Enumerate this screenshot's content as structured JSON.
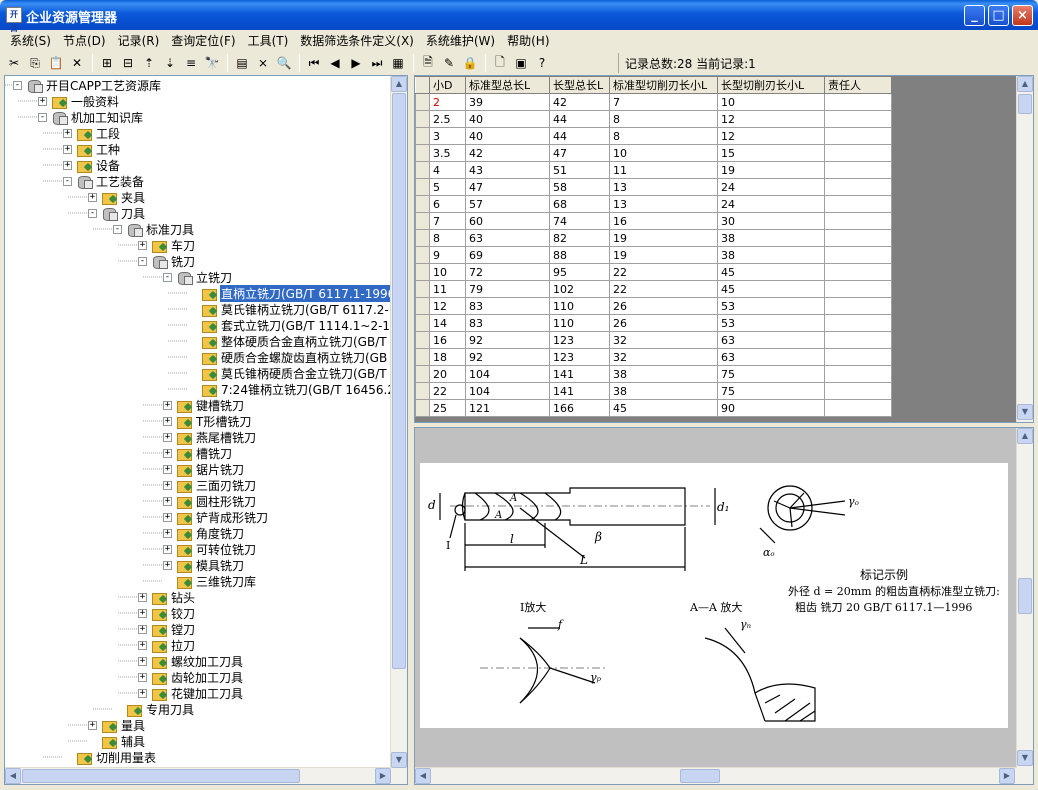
{
  "window": {
    "title": "企业资源管理器",
    "app_icon": "app-icon",
    "buttons": {
      "minimize": "_",
      "maximize": "□",
      "close": "×"
    }
  },
  "menu": [
    {
      "label": "系统(S)"
    },
    {
      "label": "节点(D)"
    },
    {
      "label": "记录(R)"
    },
    {
      "label": "查询定位(F)"
    },
    {
      "label": "工具(T)"
    },
    {
      "label": "数据筛选条件定义(X)"
    },
    {
      "label": "系统维护(W)"
    },
    {
      "label": "帮助(H)"
    }
  ],
  "toolbar": {
    "icons": [
      "cut-icon",
      "copy-icon",
      "paste-icon",
      "delete-icon",
      "new-node-icon",
      "new-child-icon",
      "move-up-icon",
      "move-down-icon",
      "level-icon",
      "find-icon",
      "table-icon",
      "filter-icon",
      "preview-icon",
      "first-record-icon",
      "prev-record-icon",
      "next-record-icon",
      "last-record-icon",
      "grid-icon",
      "properties-icon",
      "edit-icon",
      "lock-icon",
      "document-icon",
      "window-icon",
      "help-icon"
    ],
    "glyphs": [
      "✂",
      "⎘",
      "📋",
      "✕",
      "⊞",
      "⊟",
      "⇡",
      "⇣",
      "≡",
      "🔭",
      "▤",
      "⨯",
      "🔍",
      "⏮",
      "◀",
      "▶",
      "⏭",
      "▦",
      "🗎",
      "✎",
      "🔒",
      "🗋",
      "▣",
      "?"
    ],
    "status": "记录总数:28 当前记录:1"
  },
  "tree": [
    {
      "label": "开目CAPP工艺资源库",
      "level": 0,
      "exp": "-",
      "icon": "db"
    },
    {
      "label": "一般资料",
      "level": 1,
      "exp": "+",
      "icon": "folder"
    },
    {
      "label": "机加工知识库",
      "level": 1,
      "exp": "-",
      "icon": "db"
    },
    {
      "label": "工段",
      "level": 2,
      "exp": "+",
      "icon": "folder"
    },
    {
      "label": "工种",
      "level": 2,
      "exp": "+",
      "icon": "folder"
    },
    {
      "label": "设备",
      "level": 2,
      "exp": "+",
      "icon": "folder"
    },
    {
      "label": "工艺装备",
      "level": 2,
      "exp": "-",
      "icon": "db"
    },
    {
      "label": "夹具",
      "level": 3,
      "exp": "+",
      "icon": "folder"
    },
    {
      "label": "刀具",
      "level": 3,
      "exp": "-",
      "icon": "db"
    },
    {
      "label": "标准刀具",
      "level": 4,
      "exp": "-",
      "icon": "db"
    },
    {
      "label": "车刀",
      "level": 5,
      "exp": "+",
      "icon": "folder"
    },
    {
      "label": "铣刀",
      "level": 5,
      "exp": "-",
      "icon": "db"
    },
    {
      "label": "立铣刀",
      "level": 6,
      "exp": "-",
      "icon": "db"
    },
    {
      "label": "直柄立铣刀(GB/T 6117.1-1996",
      "level": 7,
      "exp": "",
      "icon": "folder",
      "selected": true
    },
    {
      "label": "莫氏锥柄立铣刀(GB/T 6117.2-",
      "level": 7,
      "exp": "",
      "icon": "folder"
    },
    {
      "label": "套式立铣刀(GB/T 1114.1~2-1'",
      "level": 7,
      "exp": "",
      "icon": "folder"
    },
    {
      "label": "整体硬质合金直柄立铣刀(GB/T",
      "level": 7,
      "exp": "",
      "icon": "folder"
    },
    {
      "label": "硬质合金螺旋齿直柄立铣刀(GB",
      "level": 7,
      "exp": "",
      "icon": "folder"
    },
    {
      "label": "莫氏锥柄硬质合金立铣刀(GB/T",
      "level": 7,
      "exp": "",
      "icon": "folder"
    },
    {
      "label": "7:24锥柄立铣刀(GB/T 16456.2",
      "level": 7,
      "exp": "",
      "icon": "folder"
    },
    {
      "label": "键槽铣刀",
      "level": 6,
      "exp": "+",
      "icon": "folder"
    },
    {
      "label": "T形槽铣刀",
      "level": 6,
      "exp": "+",
      "icon": "folder"
    },
    {
      "label": "燕尾槽铣刀",
      "level": 6,
      "exp": "+",
      "icon": "folder"
    },
    {
      "label": "槽铣刀",
      "level": 6,
      "exp": "+",
      "icon": "folder"
    },
    {
      "label": "锯片铣刀",
      "level": 6,
      "exp": "+",
      "icon": "folder"
    },
    {
      "label": "三面刃铣刀",
      "level": 6,
      "exp": "+",
      "icon": "folder"
    },
    {
      "label": "圆柱形铣刀",
      "level": 6,
      "exp": "+",
      "icon": "folder"
    },
    {
      "label": "铲背成形铣刀",
      "level": 6,
      "exp": "+",
      "icon": "folder"
    },
    {
      "label": "角度铣刀",
      "level": 6,
      "exp": "+",
      "icon": "folder"
    },
    {
      "label": "可转位铣刀",
      "level": 6,
      "exp": "+",
      "icon": "folder"
    },
    {
      "label": "模具铣刀",
      "level": 6,
      "exp": "+",
      "icon": "folder"
    },
    {
      "label": "三维铣刀库",
      "level": 6,
      "exp": "",
      "icon": "folder"
    },
    {
      "label": "钻头",
      "level": 5,
      "exp": "+",
      "icon": "folder"
    },
    {
      "label": "铰刀",
      "level": 5,
      "exp": "+",
      "icon": "folder"
    },
    {
      "label": "镗刀",
      "level": 5,
      "exp": "+",
      "icon": "folder"
    },
    {
      "label": "拉刀",
      "level": 5,
      "exp": "+",
      "icon": "folder"
    },
    {
      "label": "螺纹加工刀具",
      "level": 5,
      "exp": "+",
      "icon": "folder"
    },
    {
      "label": "齿轮加工刀具",
      "level": 5,
      "exp": "+",
      "icon": "folder"
    },
    {
      "label": "花键加工刀具",
      "level": 5,
      "exp": "+",
      "icon": "folder"
    },
    {
      "label": "专用刀具",
      "level": 4,
      "exp": "",
      "icon": "folder"
    },
    {
      "label": "量具",
      "level": 3,
      "exp": "+",
      "icon": "folder"
    },
    {
      "label": "辅具",
      "level": 3,
      "exp": "",
      "icon": "folder"
    },
    {
      "label": "切削用量表",
      "level": 2,
      "exp": "",
      "icon": "folder"
    }
  ],
  "grid": {
    "columns": [
      "小D",
      "标准型总长L",
      "长型总长L",
      "标准型切削刃长小L",
      "长型切削刃长小L",
      "责任人"
    ],
    "rows": [
      [
        "2",
        "39",
        "42",
        "7",
        "10",
        ""
      ],
      [
        "2.5",
        "40",
        "44",
        "8",
        "12",
        ""
      ],
      [
        "3",
        "40",
        "44",
        "8",
        "12",
        ""
      ],
      [
        "3.5",
        "42",
        "47",
        "10",
        "15",
        ""
      ],
      [
        "4",
        "43",
        "51",
        "11",
        "19",
        ""
      ],
      [
        "5",
        "47",
        "58",
        "13",
        "24",
        ""
      ],
      [
        "6",
        "57",
        "68",
        "13",
        "24",
        ""
      ],
      [
        "7",
        "60",
        "74",
        "16",
        "30",
        ""
      ],
      [
        "8",
        "63",
        "82",
        "19",
        "38",
        ""
      ],
      [
        "9",
        "69",
        "88",
        "19",
        "38",
        ""
      ],
      [
        "10",
        "72",
        "95",
        "22",
        "45",
        ""
      ],
      [
        "11",
        "79",
        "102",
        "22",
        "45",
        ""
      ],
      [
        "12",
        "83",
        "110",
        "26",
        "53",
        ""
      ],
      [
        "14",
        "83",
        "110",
        "26",
        "53",
        ""
      ],
      [
        "16",
        "92",
        "123",
        "32",
        "63",
        ""
      ],
      [
        "18",
        "92",
        "123",
        "32",
        "63",
        ""
      ],
      [
        "20",
        "104",
        "141",
        "38",
        "75",
        ""
      ],
      [
        "22",
        "104",
        "141",
        "38",
        "75",
        ""
      ],
      [
        "25",
        "121",
        "166",
        "45",
        "90",
        ""
      ]
    ]
  },
  "drawing": {
    "labels": {
      "d": "d",
      "d1": "d₁",
      "l": "l",
      "L": "L",
      "beta": "β",
      "A": "A",
      "I": "I",
      "gamma_o": "γₒ",
      "alpha_o": "αₒ",
      "f": "f",
      "gamma_p": "γₚ",
      "gamma_n": "γₙ",
      "I_enlarged": "I放大",
      "AA_enlarged": "A—A 放大",
      "marking_title": "标记示例",
      "marking_line1": "外径 d = 20mm 的粗齿直柄标准型立铣刀:",
      "marking_line2": "粗齿  铣刀 20   GB/T 6117.1—1996"
    }
  }
}
